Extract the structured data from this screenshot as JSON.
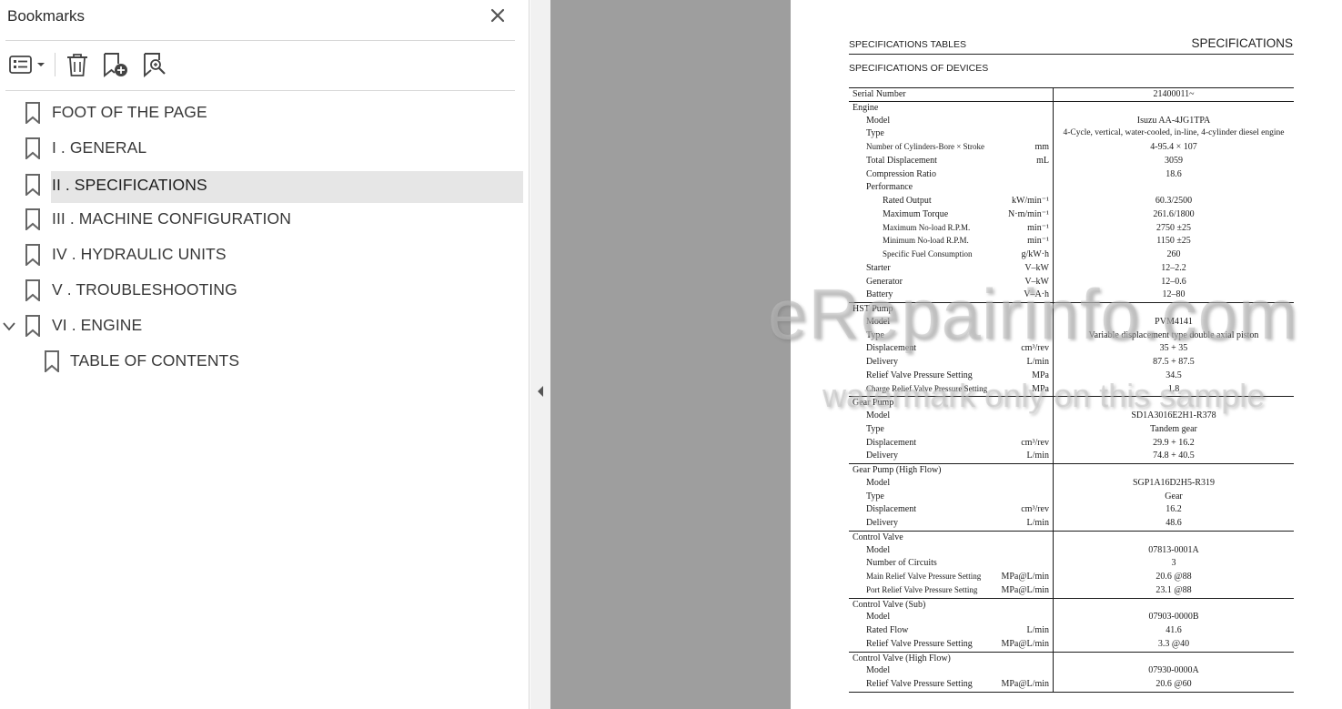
{
  "panel": {
    "title": "Bookmarks",
    "tools": [
      {
        "name": "options-menu",
        "icon": "list-options-icon"
      },
      {
        "name": "delete-bookmark",
        "icon": "trash-icon"
      },
      {
        "name": "add-bookmark",
        "icon": "bookmark-plus-icon"
      },
      {
        "name": "find-bookmark",
        "icon": "bookmark-search-icon"
      }
    ],
    "bookmarks": [
      {
        "label": "FOOT OF THE PAGE"
      },
      {
        "label": "I . GENERAL"
      },
      {
        "label": "II . SPECIFICATIONS",
        "selected": true
      },
      {
        "label": "III . MACHINE CONFIGURATION"
      },
      {
        "label": "IV . HYDRAULIC UNITS"
      },
      {
        "label": "V . TROUBLESHOOTING"
      },
      {
        "label": "VI . ENGINE",
        "expanded": true
      },
      {
        "label": "TABLE OF CONTENTS",
        "child": true
      }
    ]
  },
  "document": {
    "header_left": "SPECIFICATIONS TABLES",
    "header_right": "SPECIFICATIONS",
    "subtitle": "SPECIFICATIONS OF DEVICES",
    "rows": [
      {
        "label": "Serial Number",
        "unit": "",
        "value": "21400011~",
        "top": true,
        "level": 0
      },
      {
        "label": "Engine",
        "unit": "",
        "value": "",
        "top": true,
        "level": 0
      },
      {
        "label": "Model",
        "unit": "",
        "value": "Isuzu AA-4JG1TPA",
        "level": 1
      },
      {
        "label": "Type",
        "unit": "",
        "value": "4-Cycle, vertical, water-cooled, in-line, 4-cylinder diesel engine",
        "level": 1,
        "small_value": true
      },
      {
        "label": "Number of Cylinders-Bore × Stroke",
        "unit": "mm",
        "value": "4-95.4 × 107",
        "level": 1,
        "small": true
      },
      {
        "label": "Total Displacement",
        "unit": "mL",
        "value": "3059",
        "level": 1
      },
      {
        "label": "Compression Ratio",
        "unit": "",
        "value": "18.6",
        "level": 1
      },
      {
        "label": "Performance",
        "unit": "",
        "value": "",
        "level": 1
      },
      {
        "label": "Rated Output",
        "unit": "kW/min⁻¹",
        "value": "60.3/2500",
        "level": 2
      },
      {
        "label": "Maximum Torque",
        "unit": "N·m/min⁻¹",
        "value": "261.6/1800",
        "level": 2
      },
      {
        "label": "Maximum No-load R.P.M.",
        "unit": "min⁻¹",
        "value": "2750 ±25",
        "level": 2,
        "small": true
      },
      {
        "label": "Minimum No-load R.P.M.",
        "unit": "min⁻¹",
        "value": "1150 ±25",
        "level": 2,
        "small": true
      },
      {
        "label": "Specific Fuel Consumption",
        "unit": "g/kW·h",
        "value": "260",
        "level": 2,
        "small": true
      },
      {
        "label": "Starter",
        "unit": "V–kW",
        "value": "12–2.2",
        "level": 1
      },
      {
        "label": "Generator",
        "unit": "V–kW",
        "value": "12–0.6",
        "level": 1
      },
      {
        "label": "Battery",
        "unit": "V–A·h",
        "value": "12–80",
        "level": 1
      },
      {
        "label": "HST Pump",
        "unit": "",
        "value": "",
        "top": true,
        "level": 0
      },
      {
        "label": "Model",
        "unit": "",
        "value": "PVM4141",
        "level": 1
      },
      {
        "label": "Type",
        "unit": "",
        "value": "Variable displacement type double axial piston",
        "level": 1
      },
      {
        "label": "Displacement",
        "unit": "cm³/rev",
        "value": "35 + 35",
        "level": 1
      },
      {
        "label": "Delivery",
        "unit": "L/min",
        "value": "87.5 + 87.5",
        "level": 1
      },
      {
        "label": "Relief Valve Pressure Setting",
        "unit": "MPa",
        "value": "34.5",
        "level": 1
      },
      {
        "label": "Charge Relief Valve Pressure Setting",
        "unit": "MPa",
        "value": "1.8",
        "level": 1,
        "small": true
      },
      {
        "label": "Gear Pump",
        "unit": "",
        "value": "",
        "top": true,
        "level": 0
      },
      {
        "label": "Model",
        "unit": "",
        "value": "SD1A3016E2H1-R378",
        "level": 1
      },
      {
        "label": "Type",
        "unit": "",
        "value": "Tandem gear",
        "level": 1
      },
      {
        "label": "Displacement",
        "unit": "cm³/rev",
        "value": "29.9 + 16.2",
        "level": 1
      },
      {
        "label": "Delivery",
        "unit": "L/min",
        "value": "74.8 + 40.5",
        "level": 1
      },
      {
        "label": "Gear Pump (High Flow)",
        "unit": "",
        "value": "",
        "top": true,
        "level": 0
      },
      {
        "label": "Model",
        "unit": "",
        "value": "SGP1A16D2H5-R319",
        "level": 1
      },
      {
        "label": "Type",
        "unit": "",
        "value": "Gear",
        "level": 1
      },
      {
        "label": "Displacement",
        "unit": "cm³/rev",
        "value": "16.2",
        "level": 1
      },
      {
        "label": "Delivery",
        "unit": "L/min",
        "value": "48.6",
        "level": 1
      },
      {
        "label": "Control Valve",
        "unit": "",
        "value": "",
        "top": true,
        "level": 0
      },
      {
        "label": "Model",
        "unit": "",
        "value": "07813-0001A",
        "level": 1
      },
      {
        "label": "Number of Circuits",
        "unit": "",
        "value": "3",
        "level": 1
      },
      {
        "label": "Main Relief Valve Pressure Setting",
        "unit": "MPa@L/min",
        "value": "20.6 @88",
        "level": 1,
        "small": true
      },
      {
        "label": "Port Relief Valve Pressure Setting",
        "unit": "MPa@L/min",
        "value": "23.1 @88",
        "level": 1,
        "small": true
      },
      {
        "label": "Control Valve (Sub)",
        "unit": "",
        "value": "",
        "top": true,
        "level": 0
      },
      {
        "label": "Model",
        "unit": "",
        "value": "07903-0000B",
        "level": 1
      },
      {
        "label": "Rated Flow",
        "unit": "L/min",
        "value": "41.6",
        "level": 1
      },
      {
        "label": "Relief Valve Pressure Setting",
        "unit": "MPa@L/min",
        "value": "3.3 @40",
        "level": 1
      },
      {
        "label": "Control Valve (High Flow)",
        "unit": "",
        "value": "",
        "top": true,
        "level": 0
      },
      {
        "label": "Model",
        "unit": "",
        "value": "07930-0000A",
        "level": 1
      },
      {
        "label": "Relief Valve Pressure Setting",
        "unit": "MPa@L/min",
        "value": "20.6 @60",
        "level": 1
      }
    ]
  },
  "watermark": {
    "line1": "eRepairinfo.com",
    "line2": "watermark only on this sample"
  }
}
